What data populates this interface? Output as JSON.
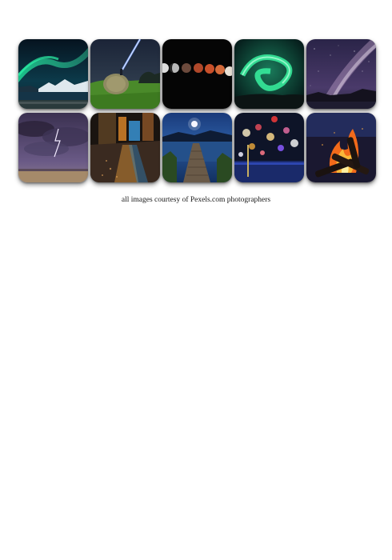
{
  "caption": "all images courtesy of Pexels.com photographers",
  "photos": [
    "aurora-over-mountains",
    "hay-bale-under-starry-sky",
    "lunar-eclipse-phases",
    "green-aurora-swirl",
    "milky-way-over-lake",
    "stormy-purple-sky",
    "wet-street-city-lights",
    "moon-over-lake-pier",
    "bokeh-city-lights",
    "campfire-flames"
  ]
}
